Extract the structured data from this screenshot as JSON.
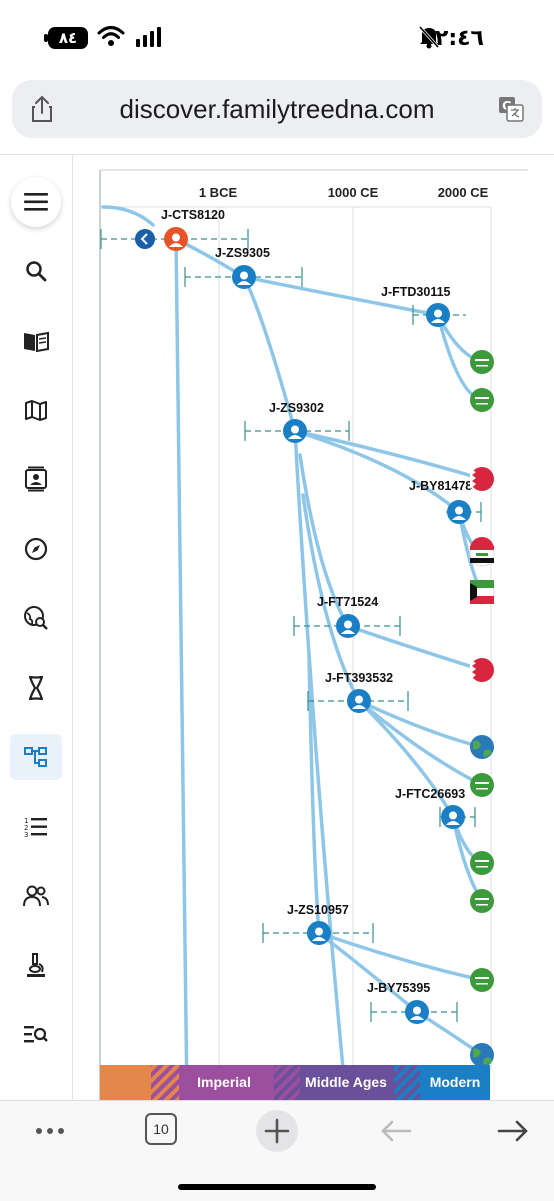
{
  "status_bar": {
    "battery": "٨٤",
    "time": "٢:٤٦"
  },
  "browser": {
    "url": "discover.familytreedna.com",
    "tab_count": "10"
  },
  "timeline": {
    "labels": [
      "1 BCE",
      "1000 CE",
      "2000 CE"
    ]
  },
  "eras": [
    "Imperial",
    "Middle Ages",
    "Modern"
  ],
  "nodes": [
    {
      "id": "J-CTS8120",
      "highlighted": true
    },
    {
      "id": "J-ZS9305"
    },
    {
      "id": "J-FTD30115"
    },
    {
      "id": "J-ZS9302"
    },
    {
      "id": "J-BY81478"
    },
    {
      "id": "J-FT71524"
    },
    {
      "id": "J-FT393532"
    },
    {
      "id": "J-FTC26693"
    },
    {
      "id": "J-ZS10957"
    },
    {
      "id": "J-BY75395"
    }
  ],
  "colors": {
    "accent": "#1a7fc4",
    "highlight": "#e8542a",
    "branch": "#8ec6e8",
    "imperial": "#9b4f9e",
    "middle_ages": "#6a4f9b",
    "modern": "#1a7fc4",
    "ancient": "#e3874a"
  }
}
